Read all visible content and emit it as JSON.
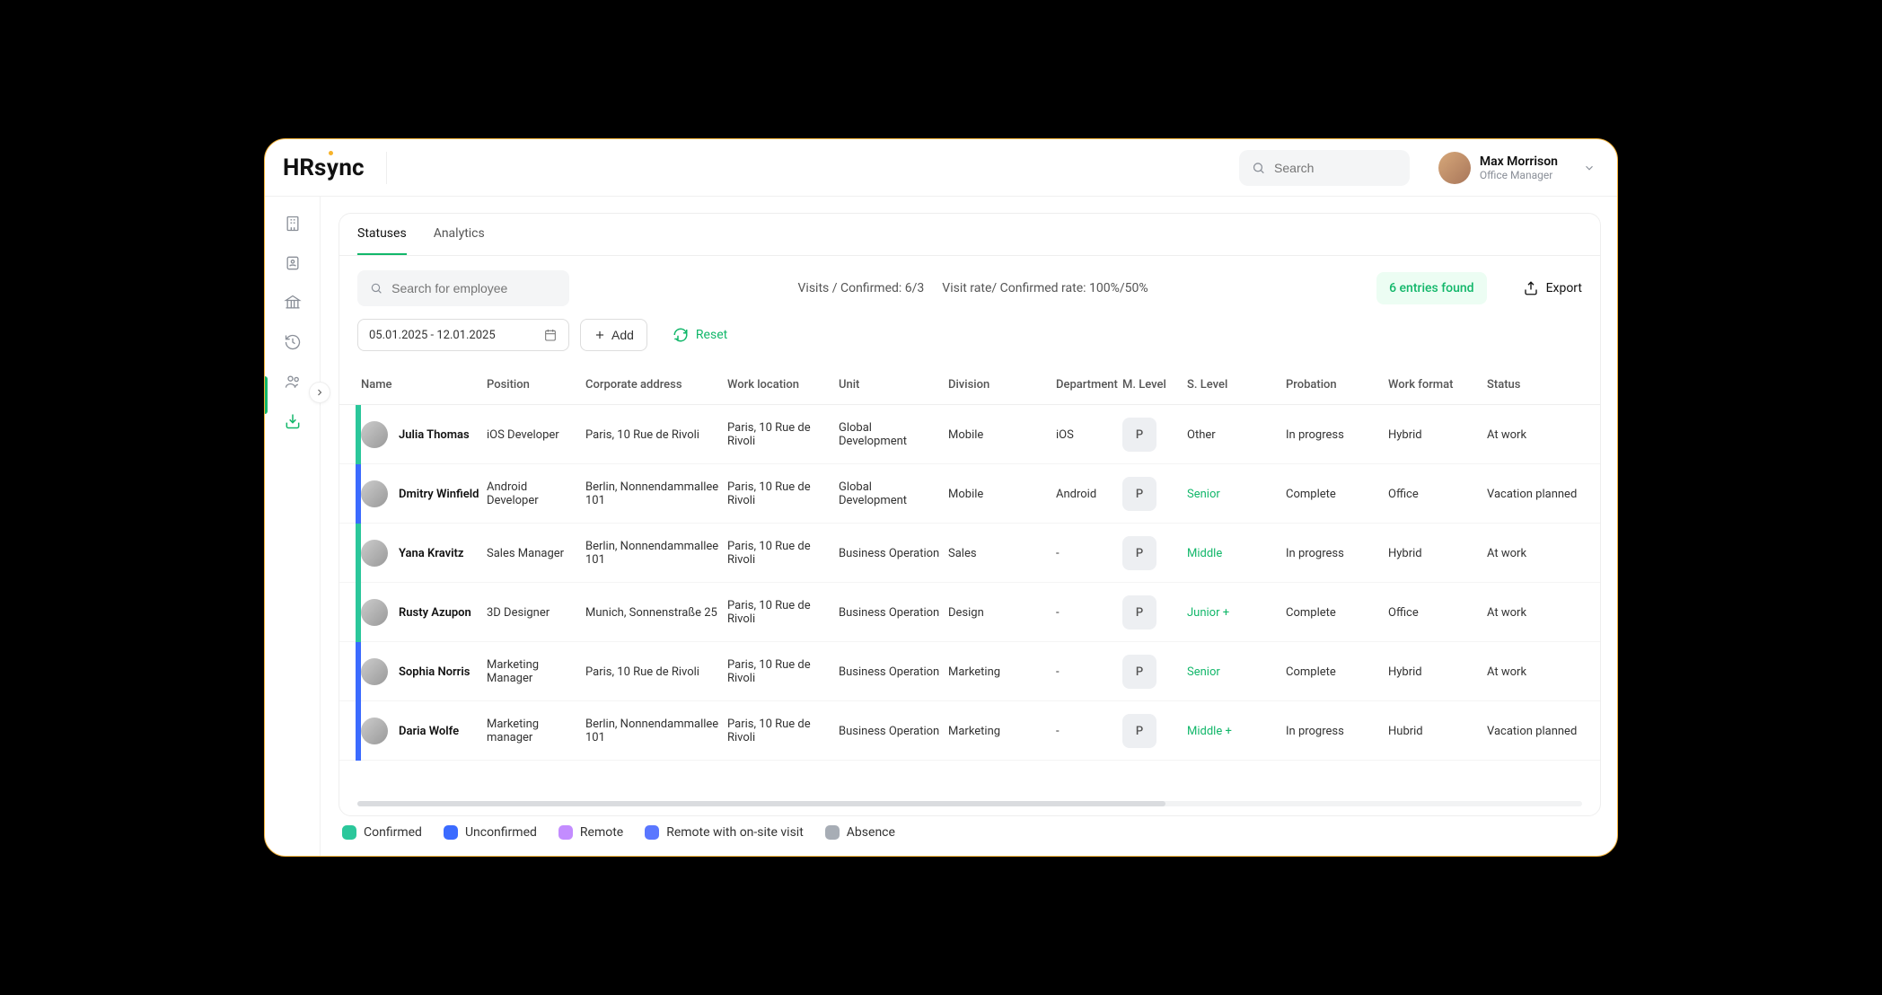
{
  "logo": {
    "text_a": "HRs",
    "text_b": "nc"
  },
  "search": {
    "placeholder": "Search"
  },
  "user": {
    "name": "Max Morrison",
    "role": "Office Manager"
  },
  "tabs": {
    "statuses": "Statuses",
    "analytics": "Analytics"
  },
  "emp_search": {
    "placeholder": "Search for employee"
  },
  "stats": {
    "visits": "Visits / Confirmed: 6/3",
    "rate": "Visit rate/ Confirmed rate: 100%/50%"
  },
  "entries": "6 entries found",
  "export": "Export",
  "date_range": "05.01.2025 - 12.01.2025",
  "add": "Add",
  "reset": "Reset",
  "columns": {
    "name": "Name",
    "position": "Position",
    "corp": "Corporate address",
    "work": "Work location",
    "unit": "Unit",
    "division": "Division",
    "dept": "Department",
    "mlevel": "M. Level",
    "slevel": "S. Level",
    "probation": "Probation",
    "format": "Work format",
    "status": "Status"
  },
  "rows": [
    {
      "bar": "c-confirmed",
      "name": "Julia Thomas",
      "position": "iOS Developer",
      "corp": "Paris, 10 Rue de Rivoli",
      "work": "Paris, 10 Rue de Rivoli",
      "unit": "Global Development",
      "division": "Mobile",
      "dept": "iOS",
      "m": "P",
      "s": "Other",
      "s_green": false,
      "probation": "In progress",
      "format": "Hybrid",
      "status": "At work"
    },
    {
      "bar": "c-unconfirmed",
      "name": "Dmitry Winfield",
      "position": "Android Developer",
      "corp": "Berlin, Nonnendammallee 101",
      "work": "Paris, 10 Rue de Rivoli",
      "unit": "Global Development",
      "division": "Mobile",
      "dept": "Android",
      "m": "P",
      "s": "Senior",
      "s_green": true,
      "probation": "Complete",
      "format": "Office",
      "status": "Vacation planned"
    },
    {
      "bar": "c-confirmed",
      "name": "Yana Kravitz",
      "position": "Sales Manager",
      "corp": "Berlin, Nonnendammallee 101",
      "work": "Paris, 10 Rue de Rivoli",
      "unit": "Business Operation",
      "division": "Sales",
      "dept": "-",
      "m": "P",
      "s": "Middle",
      "s_green": true,
      "probation": "In progress",
      "format": "Hybrid",
      "status": "At work"
    },
    {
      "bar": "c-confirmed",
      "name": "Rusty Azupon",
      "position": "3D Designer",
      "corp": "Munich, Sonnenstraße 25",
      "work": "Paris, 10 Rue de Rivoli",
      "unit": "Business Operation",
      "division": "Design",
      "dept": "-",
      "m": "P",
      "s": "Junior +",
      "s_green": true,
      "probation": "Complete",
      "format": "Office",
      "status": "At work"
    },
    {
      "bar": "c-unconfirmed",
      "name": "Sophia Norris",
      "position": "Marketing Manager",
      "corp": "Paris, 10 Rue de Rivoli",
      "work": "Paris, 10 Rue de Rivoli",
      "unit": "Business Operation",
      "division": "Marketing",
      "dept": "-",
      "m": "P",
      "s": "Senior",
      "s_green": true,
      "probation": "Complete",
      "format": "Hybrid",
      "status": "At work"
    },
    {
      "bar": "c-unconfirmed",
      "name": "Daria Wolfe",
      "position": "Marketing manager",
      "corp": "Berlin, Nonnendammallee 101",
      "work": "Paris, 10 Rue de Rivoli",
      "unit": "Business Operation",
      "division": "Marketing",
      "dept": "-",
      "m": "P",
      "s": "Middle +",
      "s_green": true,
      "probation": "In progress",
      "format": "Hubrid",
      "status": "Vacation planned"
    }
  ],
  "legend": {
    "confirmed": "Confirmed",
    "unconfirmed": "Unconfirmed",
    "remote": "Remote",
    "remote_onsite": "Remote with on-site visit",
    "absence": "Absence"
  }
}
